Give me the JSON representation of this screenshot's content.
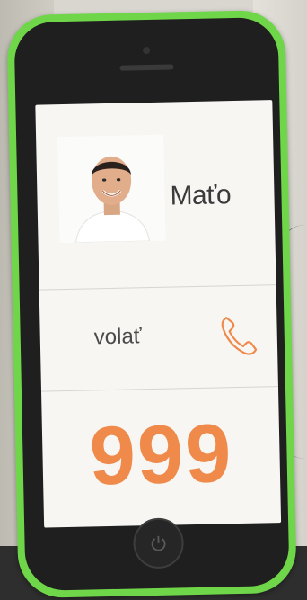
{
  "contact": {
    "name": "Maťo",
    "photo": "person-portrait"
  },
  "call": {
    "label": "volať",
    "icon": "phone-handset-icon"
  },
  "number": "999",
  "colors": {
    "phone_case": "#6fd64a",
    "accent_orange": "#ef8a4b",
    "screen_background": "#f7f6f3"
  }
}
